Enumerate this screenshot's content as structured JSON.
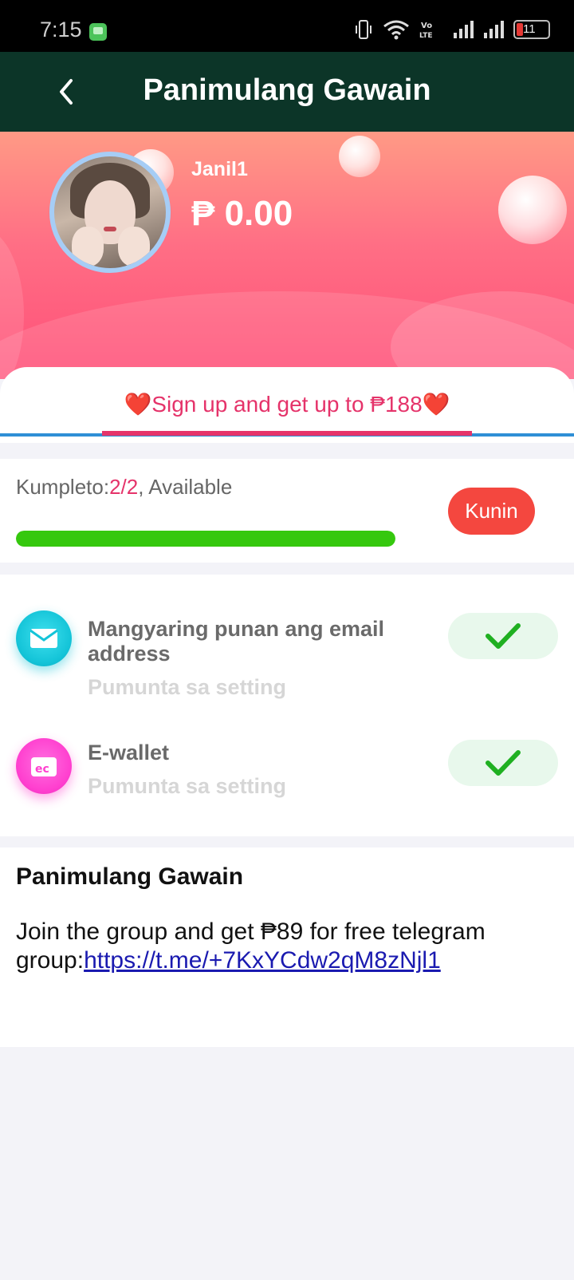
{
  "status_bar": {
    "time": "7:15",
    "battery_level": "11"
  },
  "header": {
    "title": "Panimulang Gawain"
  },
  "profile": {
    "username": "Janil1",
    "balance": "₱ 0.00"
  },
  "tab": {
    "label": "❤️Sign up and get up to ₱188❤️"
  },
  "progress": {
    "prefix": "Kumpleto:",
    "count": "2/2",
    "suffix": ", Available",
    "fraction": 1.0,
    "claim_button": "Kunin"
  },
  "tasks": [
    {
      "title": "Mangyaring punan ang email address",
      "subtitle": "Pumunta sa setting",
      "icon": "mail-icon",
      "status": "done"
    },
    {
      "title": "E-wallet",
      "subtitle": "Pumunta sa setting",
      "icon": "wallet-icon",
      "status": "done"
    }
  ],
  "description": {
    "title": "Panimulang Gawain",
    "text": "Join the group and get ₱89 for free telegram group:",
    "link": "https://t.me/+7KxYCdw2qM8zNjl1"
  },
  "colors": {
    "header_bg": "#0c3528",
    "accent_pink": "#e5336a",
    "claim_red": "#f4473f",
    "progress_green": "#35c80e"
  }
}
